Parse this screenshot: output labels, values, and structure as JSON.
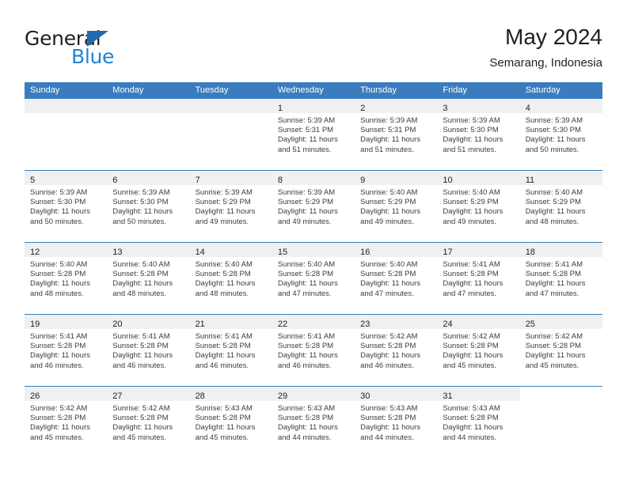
{
  "logo": {
    "word_primary": "General",
    "word_secondary": "Blue",
    "triangle_color": "#1f6bb0",
    "secondary_color": "#1f83d4"
  },
  "header": {
    "title": "May 2024",
    "subtitle": "Semarang, Indonesia"
  },
  "theme": {
    "header_row_bg": "#3a7cbe",
    "header_row_text": "#ffffff",
    "date_band_bg": "#f0f0f0",
    "row_divider": "#3a7cbe",
    "body_text": "#3c3c3c"
  },
  "calendar": {
    "weekdays": [
      "Sunday",
      "Monday",
      "Tuesday",
      "Wednesday",
      "Thursday",
      "Friday",
      "Saturday"
    ],
    "labels": {
      "sunrise_prefix": "Sunrise:",
      "sunset_prefix": "Sunset:",
      "daylight_prefix": "Daylight:"
    },
    "weeks": [
      [
        {
          "date": "",
          "blank": true
        },
        {
          "date": "",
          "blank": true
        },
        {
          "date": "",
          "blank": true
        },
        {
          "date": "1",
          "sunrise_line": "Sunrise: 5:39 AM",
          "sunset_line": "Sunset: 5:31 PM",
          "daylight_line_1": "Daylight: 11 hours",
          "daylight_line_2": "and 51 minutes."
        },
        {
          "date": "2",
          "sunrise_line": "Sunrise: 5:39 AM",
          "sunset_line": "Sunset: 5:31 PM",
          "daylight_line_1": "Daylight: 11 hours",
          "daylight_line_2": "and 51 minutes."
        },
        {
          "date": "3",
          "sunrise_line": "Sunrise: 5:39 AM",
          "sunset_line": "Sunset: 5:30 PM",
          "daylight_line_1": "Daylight: 11 hours",
          "daylight_line_2": "and 51 minutes."
        },
        {
          "date": "4",
          "sunrise_line": "Sunrise: 5:39 AM",
          "sunset_line": "Sunset: 5:30 PM",
          "daylight_line_1": "Daylight: 11 hours",
          "daylight_line_2": "and 50 minutes."
        }
      ],
      [
        {
          "date": "5",
          "sunrise_line": "Sunrise: 5:39 AM",
          "sunset_line": "Sunset: 5:30 PM",
          "daylight_line_1": "Daylight: 11 hours",
          "daylight_line_2": "and 50 minutes."
        },
        {
          "date": "6",
          "sunrise_line": "Sunrise: 5:39 AM",
          "sunset_line": "Sunset: 5:30 PM",
          "daylight_line_1": "Daylight: 11 hours",
          "daylight_line_2": "and 50 minutes."
        },
        {
          "date": "7",
          "sunrise_line": "Sunrise: 5:39 AM",
          "sunset_line": "Sunset: 5:29 PM",
          "daylight_line_1": "Daylight: 11 hours",
          "daylight_line_2": "and 49 minutes."
        },
        {
          "date": "8",
          "sunrise_line": "Sunrise: 5:39 AM",
          "sunset_line": "Sunset: 5:29 PM",
          "daylight_line_1": "Daylight: 11 hours",
          "daylight_line_2": "and 49 minutes."
        },
        {
          "date": "9",
          "sunrise_line": "Sunrise: 5:40 AM",
          "sunset_line": "Sunset: 5:29 PM",
          "daylight_line_1": "Daylight: 11 hours",
          "daylight_line_2": "and 49 minutes."
        },
        {
          "date": "10",
          "sunrise_line": "Sunrise: 5:40 AM",
          "sunset_line": "Sunset: 5:29 PM",
          "daylight_line_1": "Daylight: 11 hours",
          "daylight_line_2": "and 49 minutes."
        },
        {
          "date": "11",
          "sunrise_line": "Sunrise: 5:40 AM",
          "sunset_line": "Sunset: 5:29 PM",
          "daylight_line_1": "Daylight: 11 hours",
          "daylight_line_2": "and 48 minutes."
        }
      ],
      [
        {
          "date": "12",
          "sunrise_line": "Sunrise: 5:40 AM",
          "sunset_line": "Sunset: 5:28 PM",
          "daylight_line_1": "Daylight: 11 hours",
          "daylight_line_2": "and 48 minutes."
        },
        {
          "date": "13",
          "sunrise_line": "Sunrise: 5:40 AM",
          "sunset_line": "Sunset: 5:28 PM",
          "daylight_line_1": "Daylight: 11 hours",
          "daylight_line_2": "and 48 minutes."
        },
        {
          "date": "14",
          "sunrise_line": "Sunrise: 5:40 AM",
          "sunset_line": "Sunset: 5:28 PM",
          "daylight_line_1": "Daylight: 11 hours",
          "daylight_line_2": "and 48 minutes."
        },
        {
          "date": "15",
          "sunrise_line": "Sunrise: 5:40 AM",
          "sunset_line": "Sunset: 5:28 PM",
          "daylight_line_1": "Daylight: 11 hours",
          "daylight_line_2": "and 47 minutes."
        },
        {
          "date": "16",
          "sunrise_line": "Sunrise: 5:40 AM",
          "sunset_line": "Sunset: 5:28 PM",
          "daylight_line_1": "Daylight: 11 hours",
          "daylight_line_2": "and 47 minutes."
        },
        {
          "date": "17",
          "sunrise_line": "Sunrise: 5:41 AM",
          "sunset_line": "Sunset: 5:28 PM",
          "daylight_line_1": "Daylight: 11 hours",
          "daylight_line_2": "and 47 minutes."
        },
        {
          "date": "18",
          "sunrise_line": "Sunrise: 5:41 AM",
          "sunset_line": "Sunset: 5:28 PM",
          "daylight_line_1": "Daylight: 11 hours",
          "daylight_line_2": "and 47 minutes."
        }
      ],
      [
        {
          "date": "19",
          "sunrise_line": "Sunrise: 5:41 AM",
          "sunset_line": "Sunset: 5:28 PM",
          "daylight_line_1": "Daylight: 11 hours",
          "daylight_line_2": "and 46 minutes."
        },
        {
          "date": "20",
          "sunrise_line": "Sunrise: 5:41 AM",
          "sunset_line": "Sunset: 5:28 PM",
          "daylight_line_1": "Daylight: 11 hours",
          "daylight_line_2": "and 46 minutes."
        },
        {
          "date": "21",
          "sunrise_line": "Sunrise: 5:41 AM",
          "sunset_line": "Sunset: 5:28 PM",
          "daylight_line_1": "Daylight: 11 hours",
          "daylight_line_2": "and 46 minutes."
        },
        {
          "date": "22",
          "sunrise_line": "Sunrise: 5:41 AM",
          "sunset_line": "Sunset: 5:28 PM",
          "daylight_line_1": "Daylight: 11 hours",
          "daylight_line_2": "and 46 minutes."
        },
        {
          "date": "23",
          "sunrise_line": "Sunrise: 5:42 AM",
          "sunset_line": "Sunset: 5:28 PM",
          "daylight_line_1": "Daylight: 11 hours",
          "daylight_line_2": "and 46 minutes."
        },
        {
          "date": "24",
          "sunrise_line": "Sunrise: 5:42 AM",
          "sunset_line": "Sunset: 5:28 PM",
          "daylight_line_1": "Daylight: 11 hours",
          "daylight_line_2": "and 45 minutes."
        },
        {
          "date": "25",
          "sunrise_line": "Sunrise: 5:42 AM",
          "sunset_line": "Sunset: 5:28 PM",
          "daylight_line_1": "Daylight: 11 hours",
          "daylight_line_2": "and 45 minutes."
        }
      ],
      [
        {
          "date": "26",
          "sunrise_line": "Sunrise: 5:42 AM",
          "sunset_line": "Sunset: 5:28 PM",
          "daylight_line_1": "Daylight: 11 hours",
          "daylight_line_2": "and 45 minutes."
        },
        {
          "date": "27",
          "sunrise_line": "Sunrise: 5:42 AM",
          "sunset_line": "Sunset: 5:28 PM",
          "daylight_line_1": "Daylight: 11 hours",
          "daylight_line_2": "and 45 minutes."
        },
        {
          "date": "28",
          "sunrise_line": "Sunrise: 5:43 AM",
          "sunset_line": "Sunset: 5:28 PM",
          "daylight_line_1": "Daylight: 11 hours",
          "daylight_line_2": "and 45 minutes."
        },
        {
          "date": "29",
          "sunrise_line": "Sunrise: 5:43 AM",
          "sunset_line": "Sunset: 5:28 PM",
          "daylight_line_1": "Daylight: 11 hours",
          "daylight_line_2": "and 44 minutes."
        },
        {
          "date": "30",
          "sunrise_line": "Sunrise: 5:43 AM",
          "sunset_line": "Sunset: 5:28 PM",
          "daylight_line_1": "Daylight: 11 hours",
          "daylight_line_2": "and 44 minutes."
        },
        {
          "date": "31",
          "sunrise_line": "Sunrise: 5:43 AM",
          "sunset_line": "Sunset: 5:28 PM",
          "daylight_line_1": "Daylight: 11 hours",
          "daylight_line_2": "and 44 minutes."
        },
        {
          "date": "",
          "empty_tail": true
        }
      ]
    ]
  }
}
